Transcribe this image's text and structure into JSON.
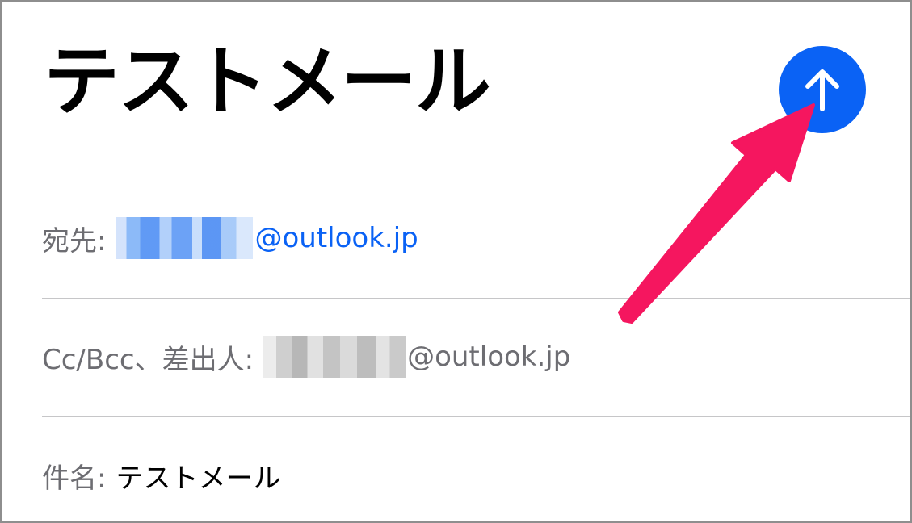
{
  "compose": {
    "title": "テストメール",
    "send_button": {
      "icon": "arrow-up-icon",
      "color": "#0a62f5"
    },
    "fields": {
      "to": {
        "label": "宛先:",
        "value": "@outlook.jp",
        "value_color": "#0a62f5"
      },
      "cc_bcc_from": {
        "label": "Cc/Bcc、差出人:",
        "value": "@outlook.jp"
      },
      "subject": {
        "label": "件名:",
        "value": "テストメール"
      }
    }
  },
  "annotation": {
    "arrow_color": "#f5165f"
  }
}
